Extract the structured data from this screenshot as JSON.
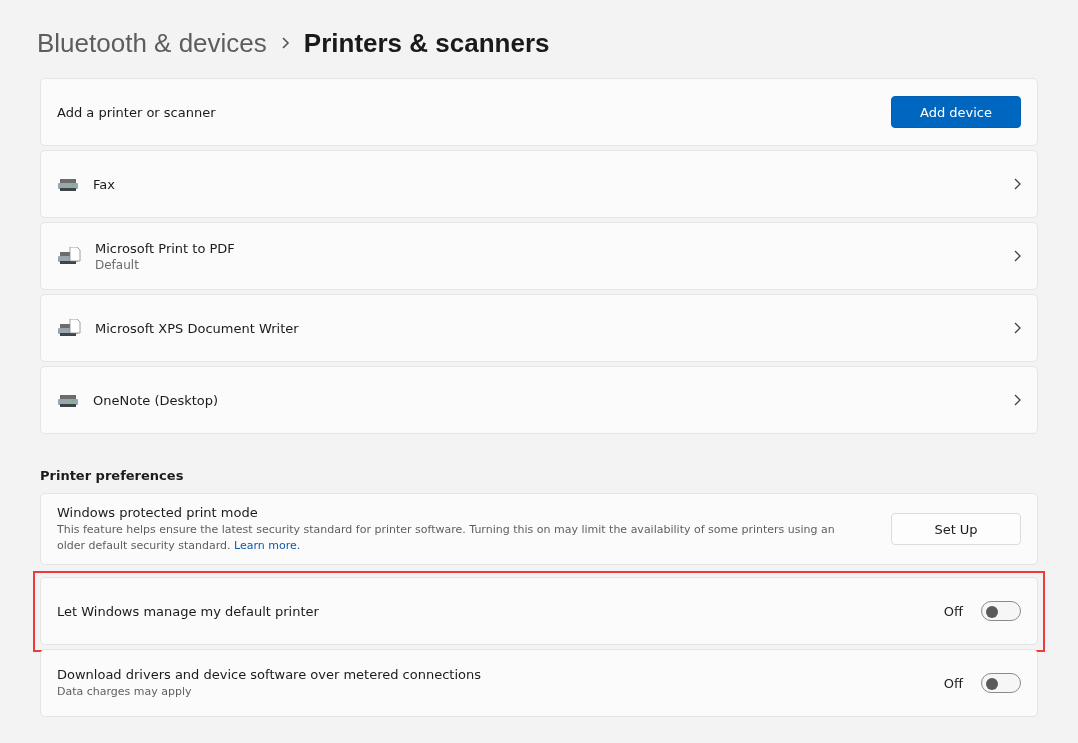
{
  "breadcrumb": {
    "parent": "Bluetooth & devices",
    "current": "Printers & scanners"
  },
  "add_card": {
    "label": "Add a printer or scanner",
    "button": "Add device"
  },
  "printers": [
    {
      "name": "Fax",
      "kind": "printer"
    },
    {
      "name": "Microsoft Print to PDF",
      "subtitle": "Default",
      "kind": "printer-document"
    },
    {
      "name": "Microsoft XPS Document Writer",
      "kind": "printer-document"
    },
    {
      "name": "OneNote (Desktop)",
      "kind": "printer"
    }
  ],
  "preferences": {
    "heading": "Printer preferences",
    "items": [
      {
        "kind": "button",
        "title": "Windows protected print mode",
        "description": "This feature helps ensure the latest security standard for printer software. Turning this on may limit the availability of some printers using an older default security standard.",
        "link": "Learn more.",
        "button": "Set Up",
        "highlighted": false
      },
      {
        "kind": "toggle",
        "title": "Let Windows manage my default printer",
        "state_label": "Off",
        "on": false,
        "highlighted": true
      },
      {
        "kind": "toggle",
        "title": "Download drivers and device software over metered connections",
        "description": "Data charges may apply",
        "state_label": "Off",
        "on": false,
        "highlighted": false
      }
    ]
  }
}
